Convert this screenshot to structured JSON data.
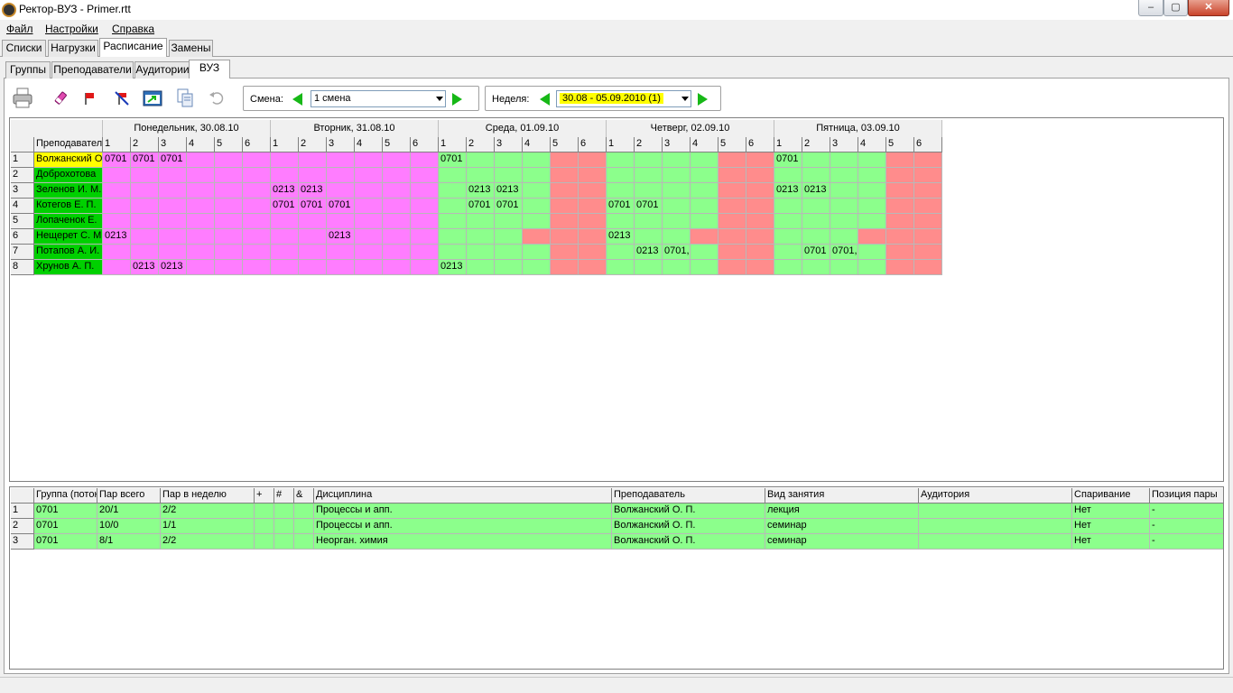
{
  "window": {
    "title": "Ректор-ВУЗ - Primer.rtt",
    "min": "‒",
    "max": "▢",
    "close": "✕"
  },
  "menu": [
    {
      "label": "Файл"
    },
    {
      "label": "Настройки"
    },
    {
      "label": "Справка"
    }
  ],
  "tabs_main": [
    {
      "label": "Списки"
    },
    {
      "label": "Нагрузки"
    },
    {
      "label": "Расписание",
      "active": true
    },
    {
      "label": "Замены"
    }
  ],
  "tabs_sub": [
    {
      "label": "Группы"
    },
    {
      "label": "Преподаватели"
    },
    {
      "label": "Аудитории"
    },
    {
      "label": "ВУЗ",
      "active": true
    }
  ],
  "toolbar": {
    "shift_label": "Смена:",
    "shift_value": "1 смена",
    "week_label": "Неделя:",
    "week_value": "30.08 - 05.09.2010  (1)"
  },
  "schedule": {
    "corner": "",
    "name_header": "Преподаватель",
    "days": [
      "Понедельник, 30.08.10",
      "Вторник, 31.08.10",
      "Среда, 01.09.10",
      "Четверг, 02.09.10",
      "Пятница, 03.09.10"
    ],
    "periods": [
      "1",
      "2",
      "3",
      "4",
      "5",
      "6"
    ],
    "rows": [
      {
        "num": "1",
        "name": "Волжанский О. П.",
        "selected": true,
        "cells": [
          "0701",
          "0701",
          "0701",
          "",
          "",
          "",
          "",
          "",
          "",
          "",
          "",
          "",
          "0701",
          "",
          "",
          "",
          "",
          "",
          "",
          "",
          "",
          "",
          "",
          "",
          "0701",
          "",
          "",
          "",
          "",
          ""
        ]
      },
      {
        "num": "2",
        "name": "Доброхотова",
        "cells": [
          "",
          "",
          "",
          "",
          "",
          "",
          "",
          "",
          "",
          "",
          "",
          "",
          "",
          "",
          "",
          "",
          "",
          "",
          "",
          "",
          "",
          "",
          "",
          "",
          "",
          "",
          "",
          "",
          "",
          ""
        ]
      },
      {
        "num": "3",
        "name": "Зеленов И. М.",
        "cells": [
          "",
          "",
          "",
          "",
          "",
          "",
          "0213",
          "0213",
          "",
          "",
          "",
          "",
          "",
          "0213",
          "0213",
          "",
          "",
          "",
          "",
          "",
          "",
          "",
          "",
          "",
          "0213",
          "0213",
          "",
          "",
          "",
          ""
        ]
      },
      {
        "num": "4",
        "name": "Котегов Е. П.",
        "cells": [
          "",
          "",
          "",
          "",
          "",
          "",
          "0701",
          "0701",
          "0701",
          "",
          "",
          "",
          "",
          "0701",
          "0701",
          "",
          "",
          "",
          "0701",
          "0701",
          "",
          "",
          "",
          "",
          "",
          "",
          "",
          "",
          "",
          ""
        ]
      },
      {
        "num": "5",
        "name": "Лопаченок Е.",
        "cells": [
          "",
          "",
          "",
          "",
          "",
          "",
          "",
          "",
          "",
          "",
          "",
          "",
          "",
          "",
          "",
          "",
          "",
          "",
          "",
          "",
          "",
          "",
          "",
          "",
          "",
          "",
          "",
          "",
          "",
          ""
        ]
      },
      {
        "num": "6",
        "name": "Нещерет С. М.",
        "cells": [
          "0213",
          "",
          "",
          "",
          "",
          "",
          "",
          "",
          "0213",
          "",
          "",
          "",
          "",
          "",
          "",
          "",
          "",
          "",
          "0213",
          "",
          "",
          "",
          "",
          "",
          "",
          "",
          "",
          "",
          "",
          ""
        ]
      },
      {
        "num": "7",
        "name": "Потапов А. И.",
        "cells": [
          "",
          "",
          "",
          "",
          "",
          "",
          "",
          "",
          "",
          "",
          "",
          "",
          "",
          "",
          "",
          "",
          "",
          "",
          "",
          "0213",
          "0701,",
          "",
          "",
          "",
          "",
          "0701",
          "0701,",
          "",
          "",
          ""
        ]
      },
      {
        "num": "8",
        "name": "Хрунов А. П.",
        "cells": [
          "",
          "0213",
          "0213",
          "",
          "",
          "",
          "",
          "",
          "",
          "",
          "",
          "",
          "0213",
          "",
          "",
          "",
          "",
          "",
          "",
          "",
          "",
          "",
          "",
          "",
          "",
          "",
          "",
          "",
          "",
          ""
        ]
      }
    ]
  },
  "details": {
    "headers": [
      "Группа (поток)",
      "Пар всего",
      "Пар в неделю",
      "+",
      "#",
      "&",
      "Дисциплина",
      "Преподаватель",
      "Вид занятия",
      "Аудитория",
      "Спаривание",
      "Позиция пары"
    ],
    "rows": [
      {
        "num": "1",
        "cells": [
          "0701",
          "20/1",
          "2/2",
          "",
          "",
          "",
          "Процессы и апп.",
          "Волжанский О. П.",
          "лекция",
          "",
          "Нет",
          "-"
        ]
      },
      {
        "num": "2",
        "cells": [
          "0701",
          "10/0",
          "1/1",
          "",
          "",
          "",
          "Процессы и апп.",
          "Волжанский О. П.",
          "семинар",
          "",
          "Нет",
          "-"
        ]
      },
      {
        "num": "3",
        "cells": [
          "0701",
          "8/1",
          "2/2",
          "",
          "",
          "",
          "Неорган. химия",
          "Волжанский О. П.",
          "семинар",
          "",
          "Нет",
          "-"
        ]
      }
    ]
  },
  "colors": {
    "busy_magenta": "#ff7dff",
    "free_green": "#8cff8c",
    "blocked_red": "#ff8c8c",
    "name_green": "#00d000",
    "selected_yellow": "#ffff00",
    "nav_arrow": "#17b817"
  }
}
